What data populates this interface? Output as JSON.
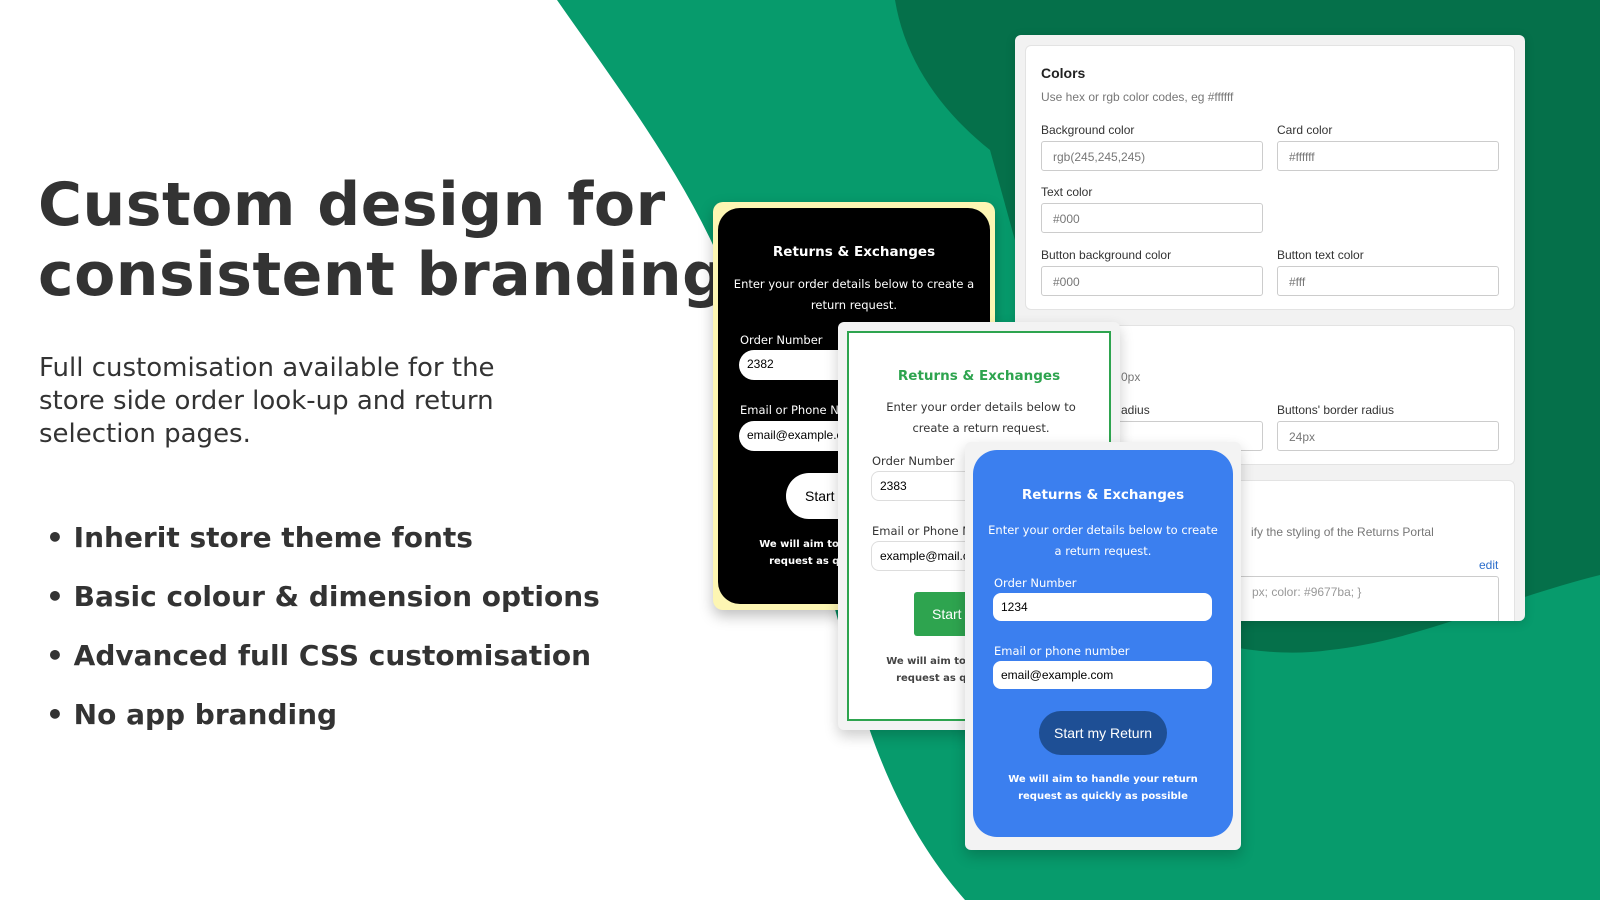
{
  "colors": {
    "brand_green": "#079b6c",
    "dark_green": "#05704a",
    "blue_portal": "#3b7fef",
    "green_accent": "#2ea44f"
  },
  "hero": {
    "title_line1": "Custom design for",
    "title_line2": "consistent branding",
    "subtitle": "Full customisation available for the store side order look-up and return selection pages.",
    "bullets": [
      "Inherit store theme fonts",
      "Basic colour & dimension options",
      "Advanced full CSS customisation",
      "No app branding"
    ]
  },
  "settings": {
    "colors": {
      "heading": "Colors",
      "hint": "Use hex or rgb color codes, eg #ffffff",
      "fields": [
        {
          "label": "Background color",
          "value": "rgb(245,245,245)"
        },
        {
          "label": "Card color",
          "value": "#ffffff"
        },
        {
          "label": "Text color",
          "value": "#000"
        },
        {
          "label": "Button background color",
          "value": "#000"
        },
        {
          "label": "Button text color",
          "value": "#fff"
        }
      ]
    },
    "dimensions": {
      "hint_fragment": "0px",
      "radius_label_fragment": "adius",
      "buttons_radius_label": "Buttons' border radius",
      "buttons_radius_value": "24px"
    },
    "css": {
      "hint_fragment": "ify the styling of the Returns Portal",
      "edit_link": "edit",
      "code_fragment": "px; color: #9677ba; }"
    }
  },
  "portals": {
    "black": {
      "title": "Returns & Exchanges",
      "description": "Enter your order details below to create a return request.",
      "order_label": "Order Number",
      "order_value": "2382",
      "email_label": "Email or Phone Number",
      "email_value": "email@example.com",
      "button": "Start my Return",
      "footer": "We will aim to handle your return request as quickly as possible"
    },
    "green": {
      "title": "Returns & Exchanges",
      "description": "Enter your order details below to create a return request.",
      "order_label": "Order Number",
      "order_value": "2383",
      "email_label": "Email or Phone Number",
      "email_value": "example@mail.com",
      "button": "Start my Return",
      "footer": "We will aim to handle your return request as quickly as possible"
    },
    "blue": {
      "title": "Returns & Exchanges",
      "description": "Enter your order details below to create a return request.",
      "order_label": "Order Number",
      "order_value": "1234",
      "email_label": "Email or phone number",
      "email_value": "email@example.com",
      "button": "Start my Return",
      "footer": "We will aim to handle your return request as quickly as possible"
    }
  }
}
